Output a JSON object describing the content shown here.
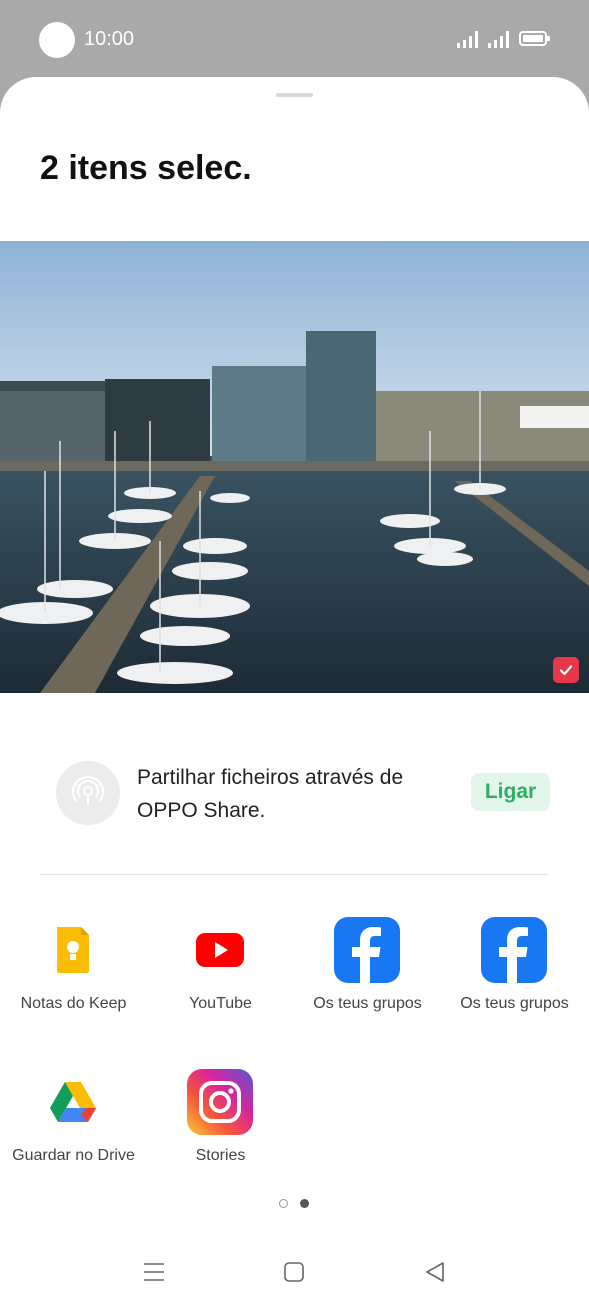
{
  "status_bar": {
    "time": "10:00"
  },
  "sheet": {
    "title": "2 itens selec."
  },
  "oppo_share": {
    "text": "Partilhar ficheiros através de OPPO Share.",
    "button_label": "Ligar"
  },
  "apps": [
    {
      "label": "Notas do Keep",
      "icon": "keep-icon"
    },
    {
      "label": "YouTube",
      "icon": "youtube-icon"
    },
    {
      "label": "Os teus grupos",
      "icon": "facebook-icon"
    },
    {
      "label": "Os teus grupos",
      "icon": "facebook-icon"
    },
    {
      "label": "Guardar no Drive",
      "icon": "drive-icon"
    },
    {
      "label": "Stories",
      "icon": "instagram-icon"
    }
  ],
  "pagination": {
    "pages": 2,
    "current": 2
  },
  "colors": {
    "accent_green": "#2fae63",
    "check_red": "#e8364a"
  }
}
